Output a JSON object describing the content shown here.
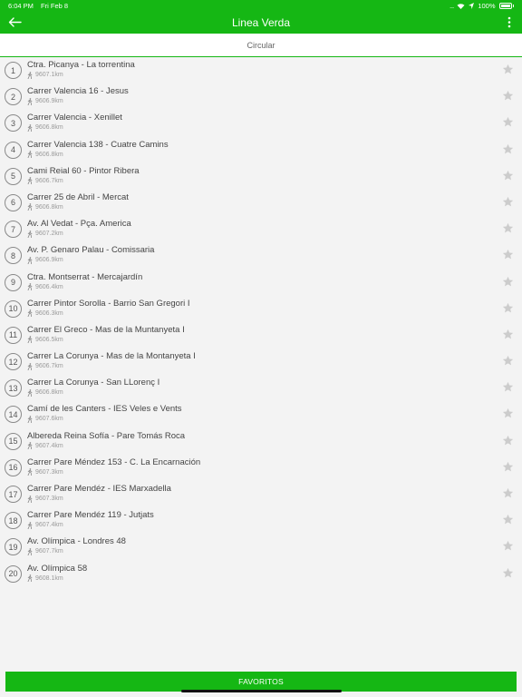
{
  "status_bar": {
    "time": "6:04 PM",
    "date": "Fri Feb 8",
    "battery": "100%"
  },
  "app_bar": {
    "title": "Linea Verda",
    "back_icon": "arrow-left-icon",
    "menu_icon": "more-vert-icon"
  },
  "subheader": {
    "label": "Circular"
  },
  "stops": [
    {
      "number": "1",
      "name": "Ctra. Picanya - La torrentina",
      "distance": "9607.1km"
    },
    {
      "number": "2",
      "name": "Carrer Valencia 16 - Jesus",
      "distance": "9606.9km"
    },
    {
      "number": "3",
      "name": "Carrer Valencia - Xenillet",
      "distance": "9606.8km"
    },
    {
      "number": "4",
      "name": "Carrer Valencia 138 - Cuatre Camins",
      "distance": "9606.8km"
    },
    {
      "number": "5",
      "name": "Cami Reial 60 - Pintor Ribera",
      "distance": "9606.7km"
    },
    {
      "number": "6",
      "name": "Carrer 25 de Abril - Mercat",
      "distance": "9606.8km"
    },
    {
      "number": "7",
      "name": "Av. Al Vedat - Pça. America",
      "distance": "9607.2km"
    },
    {
      "number": "8",
      "name": "Av. P. Genaro Palau - Comissaria",
      "distance": "9606.9km"
    },
    {
      "number": "9",
      "name": "Ctra. Montserrat - Mercajardín",
      "distance": "9606.4km"
    },
    {
      "number": "10",
      "name": "Carrer Pintor Sorolla - Barrio San Gregori I",
      "distance": "9606.3km"
    },
    {
      "number": "11",
      "name": "Carrer  El Greco - Mas de la Muntanyeta I",
      "distance": "9606.5km"
    },
    {
      "number": "12",
      "name": "Carrer La Corunya - Mas de la Montanyeta I",
      "distance": "9606.7km"
    },
    {
      "number": "13",
      "name": "Carrer La Corunya - San LLorenç I",
      "distance": "9606.8km"
    },
    {
      "number": "14",
      "name": "Camí de les Canters - IES Veles e Vents",
      "distance": "9607.6km"
    },
    {
      "number": "15",
      "name": "Albereda Reina Sofía  - Pare Tomás Roca",
      "distance": "9607.4km"
    },
    {
      "number": "16",
      "name": "Carrer Pare Méndez 153 - C. La Encarnación",
      "distance": "9607.3km"
    },
    {
      "number": "17",
      "name": "Carrer Pare Mendéz - IES Marxadella",
      "distance": "9607.3km"
    },
    {
      "number": "18",
      "name": "Carrer Pare Mendéz 119 - Jutjats",
      "distance": "9607.4km"
    },
    {
      "number": "19",
      "name": "Av. Olímpica - Londres 48",
      "distance": "9607.7km"
    },
    {
      "number": "20",
      "name": "Av. Olímpica 58",
      "distance": "9608.1km"
    }
  ],
  "footer": {
    "favorites_label": "FAVORITOS"
  },
  "colors": {
    "primary": "#15b714",
    "star": "#cccccc"
  }
}
